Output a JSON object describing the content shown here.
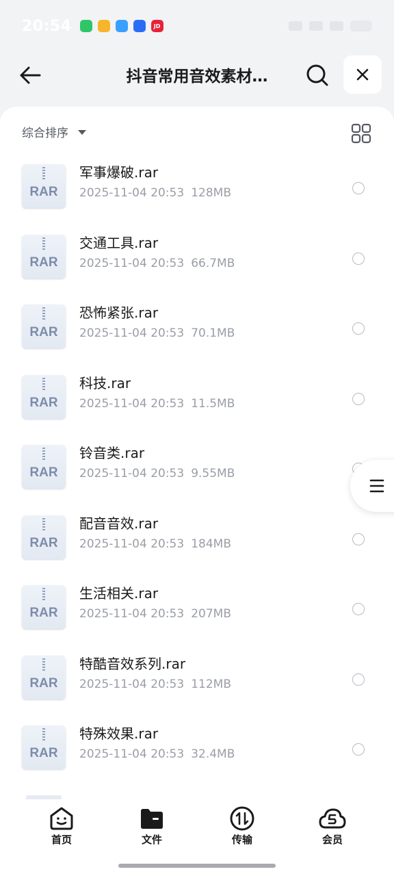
{
  "status_bar": {
    "time": "20:54",
    "apps": [
      {
        "icon": "green-cycle-app-icon",
        "color": "#2fc66a",
        "text": ""
      },
      {
        "icon": "mail-app-icon",
        "color": "#f6b52a",
        "text": ""
      },
      {
        "icon": "bird-app-icon",
        "color": "#3aa0ff",
        "text": ""
      },
      {
        "icon": "baidu-paw-app-icon",
        "color": "#2b6cf6",
        "text": ""
      },
      {
        "icon": "jd-app-icon",
        "color": "#e8223a",
        "text": "JD"
      }
    ]
  },
  "header": {
    "title": "抖音常用音效素材…",
    "back_icon": "back-arrow-icon",
    "search_icon": "search-icon",
    "close_icon": "close-icon"
  },
  "toolbar": {
    "sort_label": "综合排序",
    "view_icon": "grid-view-icon"
  },
  "files": [
    {
      "name": "军事爆破.rar",
      "date": "2025-11-04 20:53",
      "size": "128MB",
      "icon_label": "RAR"
    },
    {
      "name": "交通工具.rar",
      "date": "2025-11-04 20:53",
      "size": "66.7MB",
      "icon_label": "RAR"
    },
    {
      "name": "恐怖紧张.rar",
      "date": "2025-11-04 20:53",
      "size": "70.1MB",
      "icon_label": "RAR"
    },
    {
      "name": "科技.rar",
      "date": "2025-11-04 20:53",
      "size": "11.5MB",
      "icon_label": "RAR"
    },
    {
      "name": "铃音类.rar",
      "date": "2025-11-04 20:53",
      "size": "9.55MB",
      "icon_label": "RAR"
    },
    {
      "name": "配音音效.rar",
      "date": "2025-11-04 20:53",
      "size": "184MB",
      "icon_label": "RAR"
    },
    {
      "name": "生活相关.rar",
      "date": "2025-11-04 20:53",
      "size": "207MB",
      "icon_label": "RAR"
    },
    {
      "name": "特酷音效系列.rar",
      "date": "2025-11-04 20:53",
      "size": "112MB",
      "icon_label": "RAR"
    },
    {
      "name": "特殊效果.rar",
      "date": "2025-11-04 20:53",
      "size": "32.4MB",
      "icon_label": "RAR"
    }
  ],
  "bottom_nav": [
    {
      "label": "首页",
      "icon": "home-face-icon"
    },
    {
      "label": "文件",
      "icon": "folder-icon",
      "active": true
    },
    {
      "label": "传输",
      "icon": "transfer-icon"
    },
    {
      "label": "会员",
      "icon": "cloud-member-icon"
    }
  ],
  "colors": {
    "background": "#f2f3f5",
    "rar_label": "#7c8cab",
    "meta_text": "#9a9ea6"
  }
}
